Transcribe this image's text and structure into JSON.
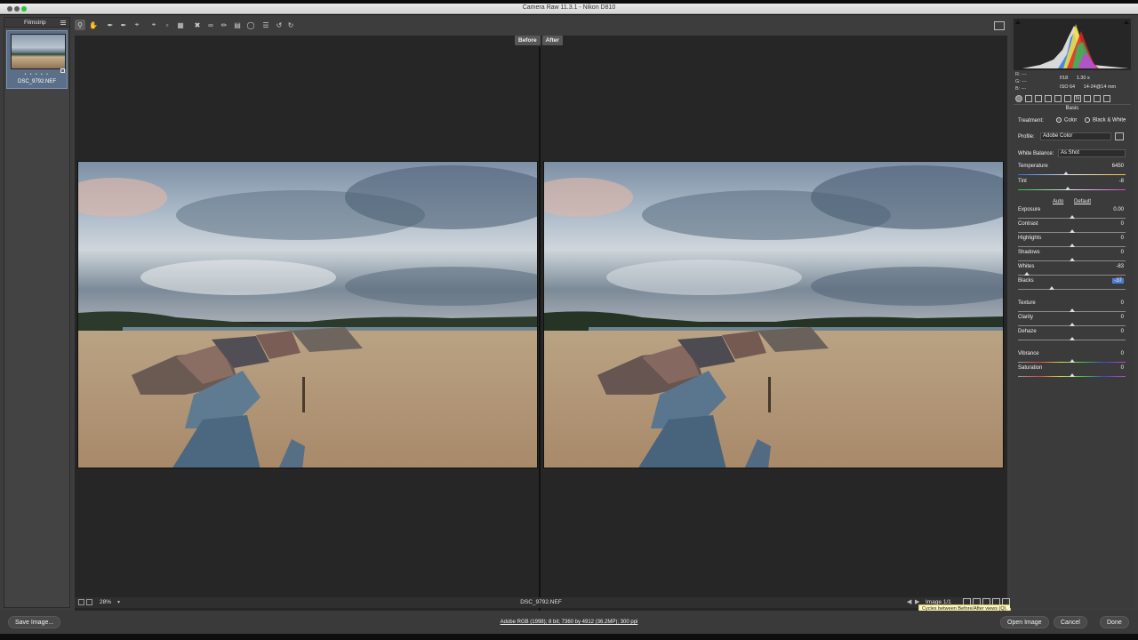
{
  "window": {
    "title": "Camera Raw 11.3.1  -  Nikon D810"
  },
  "filmstrip": {
    "title": "Filmstrip",
    "items": [
      {
        "name": "DSC_9792.NEF",
        "rating": "• • • • •"
      }
    ]
  },
  "preview": {
    "before_label": "Before",
    "after_label": "After"
  },
  "statusbar": {
    "zoom": "28%",
    "filename": "DSC_9792.NEF",
    "image_count": "Image 1/1",
    "tooltip": "Cycles between Before/After views (Q)."
  },
  "bottombar": {
    "save_label": "Save Image...",
    "workflow_info": "Adobe RGB (1998); 8 bit; 7360 by 4912 (36.2MP); 300 ppi",
    "open_label": "Open Image",
    "cancel_label": "Cancel",
    "done_label": "Done"
  },
  "panel": {
    "rgb": {
      "r": "R:   ---",
      "g": "G:   ---",
      "b": "B:   ---"
    },
    "exif": {
      "aperture": "f/18",
      "shutter": "1.30 s",
      "iso": "ISO 64",
      "lens": "14-24@14 mm"
    },
    "section_title": "Basic",
    "treatment": {
      "label": "Treatment:",
      "color": "Color",
      "bw": "Black & White"
    },
    "profile": {
      "label": "Profile:",
      "value": "Adobe Color"
    },
    "white_balance": {
      "label": "White Balance:",
      "value": "As Shot"
    },
    "auto_label": "Auto",
    "default_label": "Default",
    "sliders": [
      {
        "label": "Temperature",
        "value": "6450",
        "pos": 0.45
      },
      {
        "label": "Tint",
        "value": "-8",
        "pos": 0.46
      },
      {
        "label": "Exposure",
        "value": "0.00",
        "pos": 0.5
      },
      {
        "label": "Contrast",
        "value": "0",
        "pos": 0.5
      },
      {
        "label": "Highlights",
        "value": "0",
        "pos": 0.5
      },
      {
        "label": "Shadows",
        "value": "0",
        "pos": 0.5
      },
      {
        "label": "Whites",
        "value": "-83",
        "pos": 0.085
      },
      {
        "label": "Blacks",
        "value": "-37",
        "pos": 0.315
      },
      {
        "label": "Texture",
        "value": "0",
        "pos": 0.5
      },
      {
        "label": "Clarity",
        "value": "0",
        "pos": 0.5
      },
      {
        "label": "Dehaze",
        "value": "0",
        "pos": 0.5
      },
      {
        "label": "Vibrance",
        "value": "0",
        "pos": 0.5
      },
      {
        "label": "Saturation",
        "value": "0",
        "pos": 0.5
      }
    ]
  },
  "colors": {
    "accent": "#4f7fd3",
    "tooltip_bg": "#fff7b8",
    "green_light": "#2bc43a"
  },
  "icons": {
    "toolbar": [
      "zoom-icon",
      "hand-icon",
      "white-balance-icon",
      "color-sampler-icon",
      "targeted-adjustment-icon",
      "crop-icon",
      "straighten-icon",
      "transform-icon",
      "spot-removal-icon",
      "red-eye-icon",
      "adjustment-brush-icon",
      "graduated-filter-icon",
      "radial-filter-icon",
      "preferences-icon",
      "rotate-left-icon",
      "rotate-right-icon"
    ]
  }
}
